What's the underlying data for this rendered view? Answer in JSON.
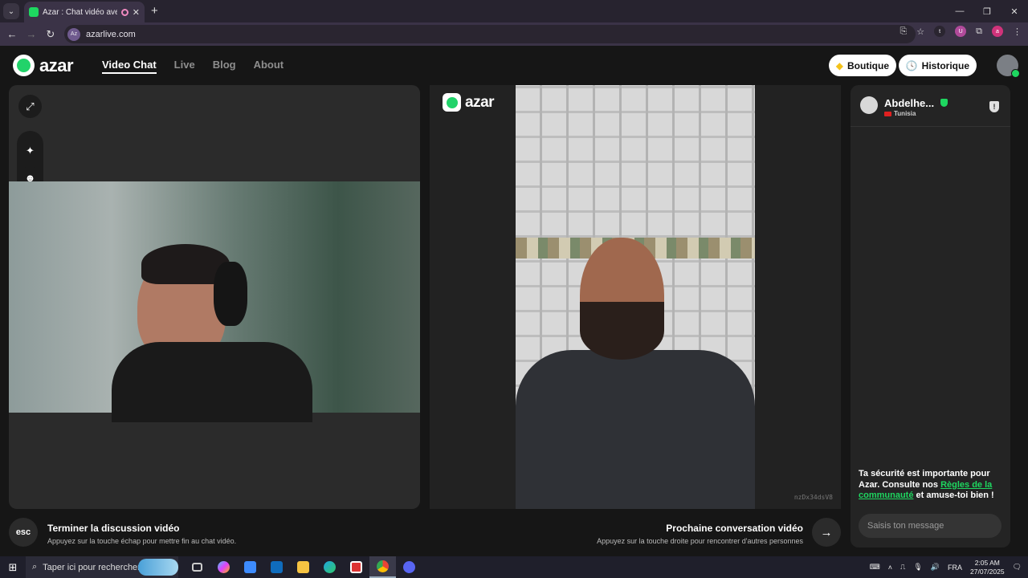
{
  "browser": {
    "tab_title": "Azar : Chat vidéo avec de n",
    "tab_close": "✕",
    "new_tab": "+",
    "url": "azarlive.com",
    "site_badge": "Az",
    "ext_label_t": "t",
    "ext_label_u": "U",
    "profile_initial": "a",
    "win_minimize": "—",
    "win_restore": "❐",
    "win_close": "✕"
  },
  "header": {
    "logo_text": "azar",
    "nav": [
      {
        "label": "Video Chat",
        "active": true
      },
      {
        "label": "Live",
        "active": false
      },
      {
        "label": "Blog",
        "active": false
      },
      {
        "label": "About",
        "active": false
      }
    ],
    "shop_label": "Boutique",
    "history_label": "Historique"
  },
  "center": {
    "logo_text": "azar",
    "video_id": "nzDx34dsV8"
  },
  "chat": {
    "partner_name": "Abdelhe...",
    "partner_country": "Tunisia",
    "safety_prefix": "Ta sécurité est importante pour Azar. Consulte nos ",
    "safety_link": "Règles de la communauté",
    "safety_suffix": " et amuse-toi bien !",
    "input_placeholder": "Saisis ton message"
  },
  "bottom": {
    "esc_label": "esc",
    "end_title": "Terminer la discussion vidéo",
    "end_sub": "Appuyez sur la touche échap pour mettre fin au chat vidéo.",
    "next_title": "Prochaine conversation vidéo",
    "next_sub": "Appuyez sur la touche droite pour rencontrer d'autres personnes"
  },
  "taskbar": {
    "search_placeholder": "Taper ici pour rechercher",
    "lang": "FRA",
    "time": "2:05 AM",
    "date": "27/07/2025"
  },
  "colors": {
    "accent": "#1ed760",
    "background": "#161616",
    "panel": "#2b2b2b"
  }
}
